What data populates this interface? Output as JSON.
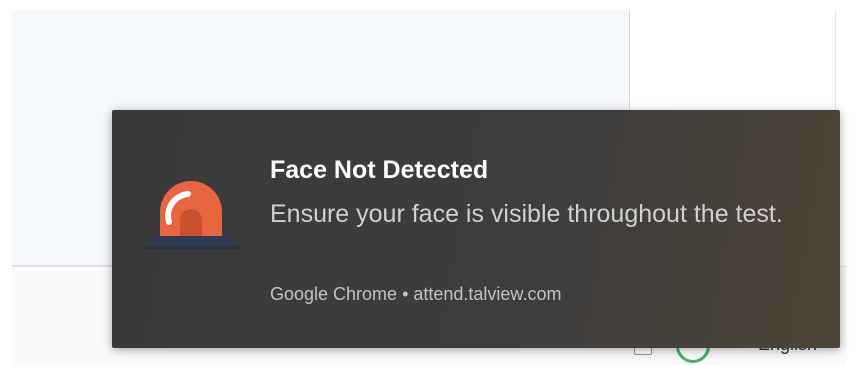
{
  "background": {
    "language_label": "English"
  },
  "notification": {
    "icon": "siren-alarm-icon",
    "title": "Face Not Detected",
    "body": "Ensure your face is visible throughout the test.",
    "source": "Google Chrome • attend.talview.com",
    "colors": {
      "background": "#3d3d3d",
      "title": "#ffffff",
      "body": "#d0d0d0",
      "siren": "#e8653f",
      "siren_base": "#2f3b52"
    }
  }
}
